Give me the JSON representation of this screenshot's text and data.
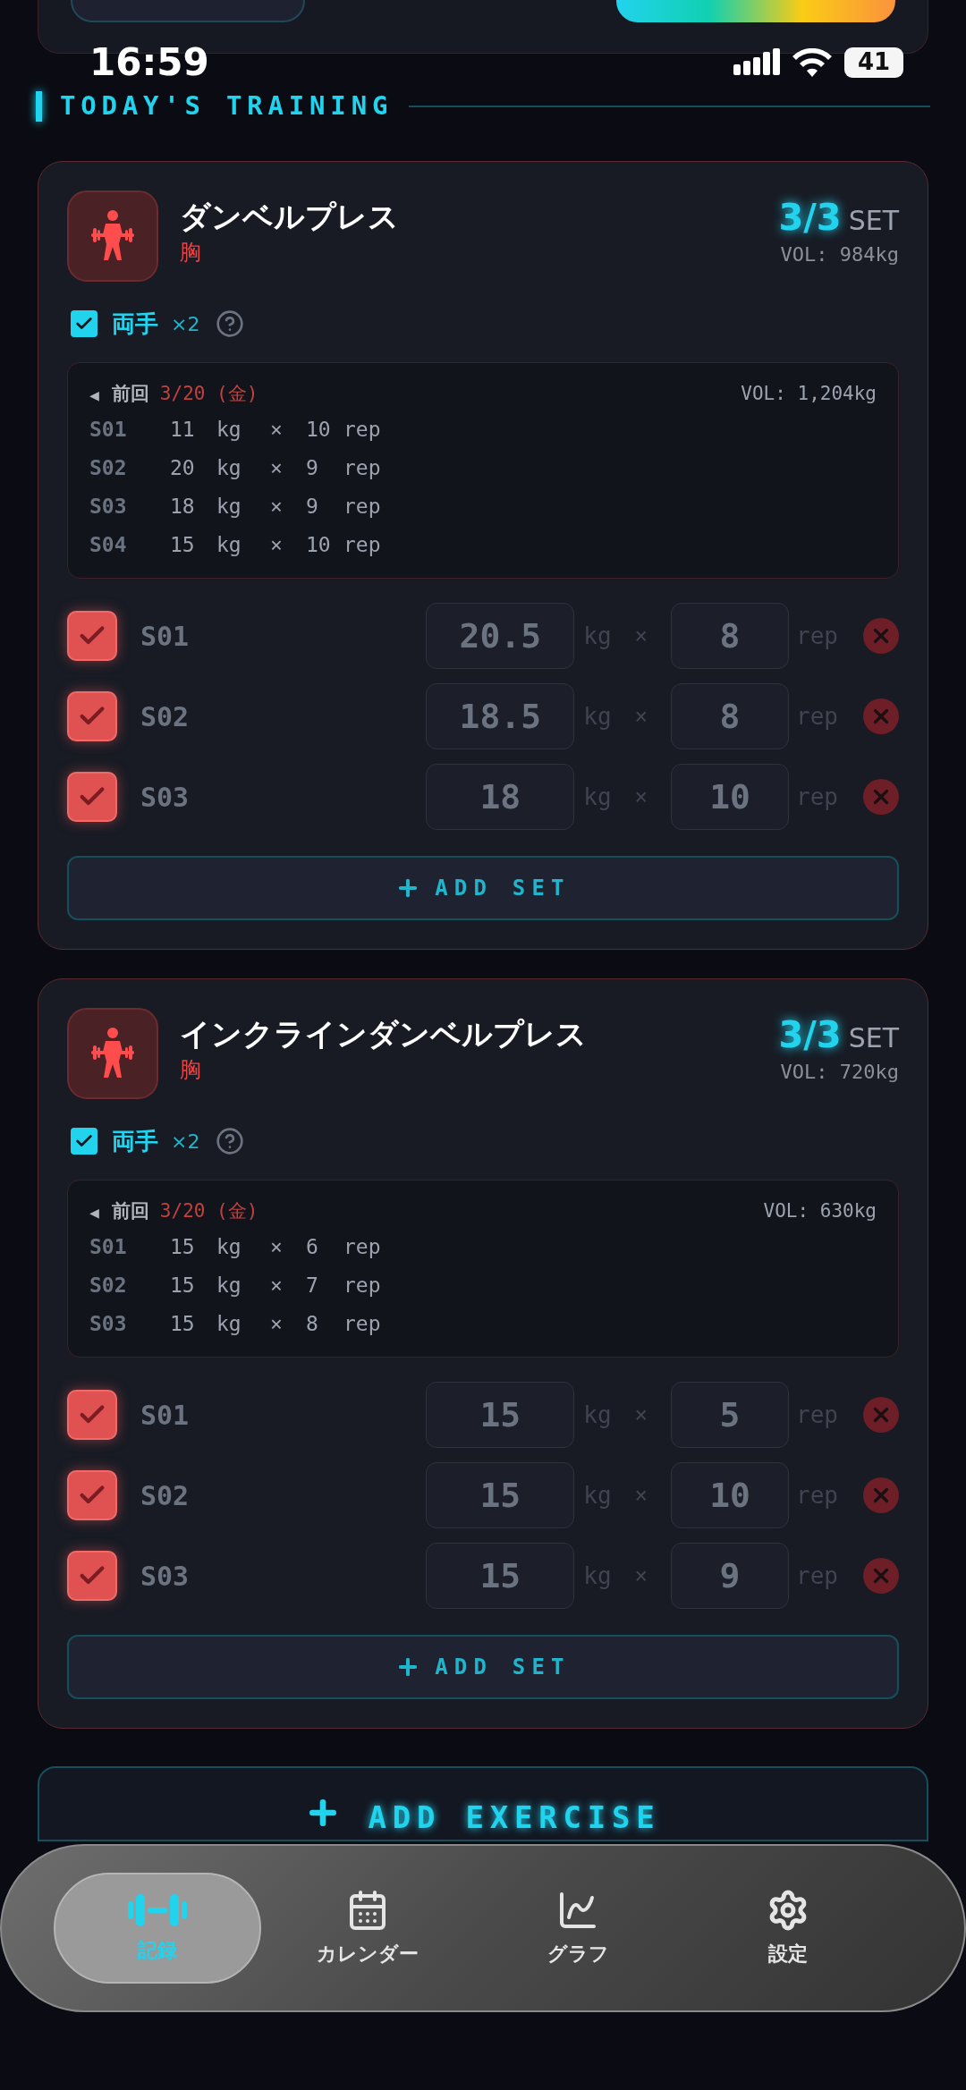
{
  "status_bar": {
    "time": "16:59",
    "battery": "41"
  },
  "section_title": "TODAY'S TRAINING",
  "exercises": [
    {
      "name": "ダンベルプレス",
      "muscle": "胸",
      "sets_done": "3/3",
      "sets_unit": "SET",
      "volume": "VOL: 984kg",
      "both_hands": {
        "checked": true,
        "label": "両手",
        "multiplier": "×2"
      },
      "previous": {
        "arrow": "◀",
        "label": "前回",
        "date": "3/20 (金)",
        "volume": "VOL: 1,204kg",
        "sets": [
          {
            "set": "S01",
            "weight": "11",
            "weight_unit": "kg",
            "times": "×",
            "reps": "10",
            "reps_unit": "rep"
          },
          {
            "set": "S02",
            "weight": "20",
            "weight_unit": "kg",
            "times": "×",
            "reps": "9",
            "reps_unit": "rep"
          },
          {
            "set": "S03",
            "weight": "18",
            "weight_unit": "kg",
            "times": "×",
            "reps": "9",
            "reps_unit": "rep"
          },
          {
            "set": "S04",
            "weight": "15",
            "weight_unit": "kg",
            "times": "×",
            "reps": "10",
            "reps_unit": "rep"
          }
        ]
      },
      "sets": [
        {
          "label": "S01",
          "checked": true,
          "weight": "20.5",
          "weight_unit": "kg",
          "times": "×",
          "reps": "8",
          "reps_unit": "rep"
        },
        {
          "label": "S02",
          "checked": true,
          "weight": "18.5",
          "weight_unit": "kg",
          "times": "×",
          "reps": "8",
          "reps_unit": "rep"
        },
        {
          "label": "S03",
          "checked": true,
          "weight": "18",
          "weight_unit": "kg",
          "times": "×",
          "reps": "10",
          "reps_unit": "rep"
        }
      ],
      "add_set": "ADD SET"
    },
    {
      "name": "インクラインダンベルプレス",
      "muscle": "胸",
      "sets_done": "3/3",
      "sets_unit": "SET",
      "volume": "VOL: 720kg",
      "both_hands": {
        "checked": true,
        "label": "両手",
        "multiplier": "×2"
      },
      "previous": {
        "arrow": "◀",
        "label": "前回",
        "date": "3/20 (金)",
        "volume": "VOL: 630kg",
        "sets": [
          {
            "set": "S01",
            "weight": "15",
            "weight_unit": "kg",
            "times": "×",
            "reps": "6",
            "reps_unit": "rep"
          },
          {
            "set": "S02",
            "weight": "15",
            "weight_unit": "kg",
            "times": "×",
            "reps": "7",
            "reps_unit": "rep"
          },
          {
            "set": "S03",
            "weight": "15",
            "weight_unit": "kg",
            "times": "×",
            "reps": "8",
            "reps_unit": "rep"
          }
        ]
      },
      "sets": [
        {
          "label": "S01",
          "checked": true,
          "weight": "15",
          "weight_unit": "kg",
          "times": "×",
          "reps": "5",
          "reps_unit": "rep"
        },
        {
          "label": "S02",
          "checked": true,
          "weight": "15",
          "weight_unit": "kg",
          "times": "×",
          "reps": "10",
          "reps_unit": "rep"
        },
        {
          "label": "S03",
          "checked": true,
          "weight": "15",
          "weight_unit": "kg",
          "times": "×",
          "reps": "9",
          "reps_unit": "rep"
        }
      ],
      "add_set": "ADD SET"
    }
  ],
  "add_exercise": "ADD EXERCISE",
  "nav": [
    {
      "kind": "record",
      "label": "記録",
      "selected": true
    },
    {
      "kind": "calendar",
      "label": "カレンダー",
      "selected": false
    },
    {
      "kind": "graph",
      "label": "グラフ",
      "selected": false
    },
    {
      "kind": "settings",
      "label": "設定",
      "selected": false
    }
  ]
}
